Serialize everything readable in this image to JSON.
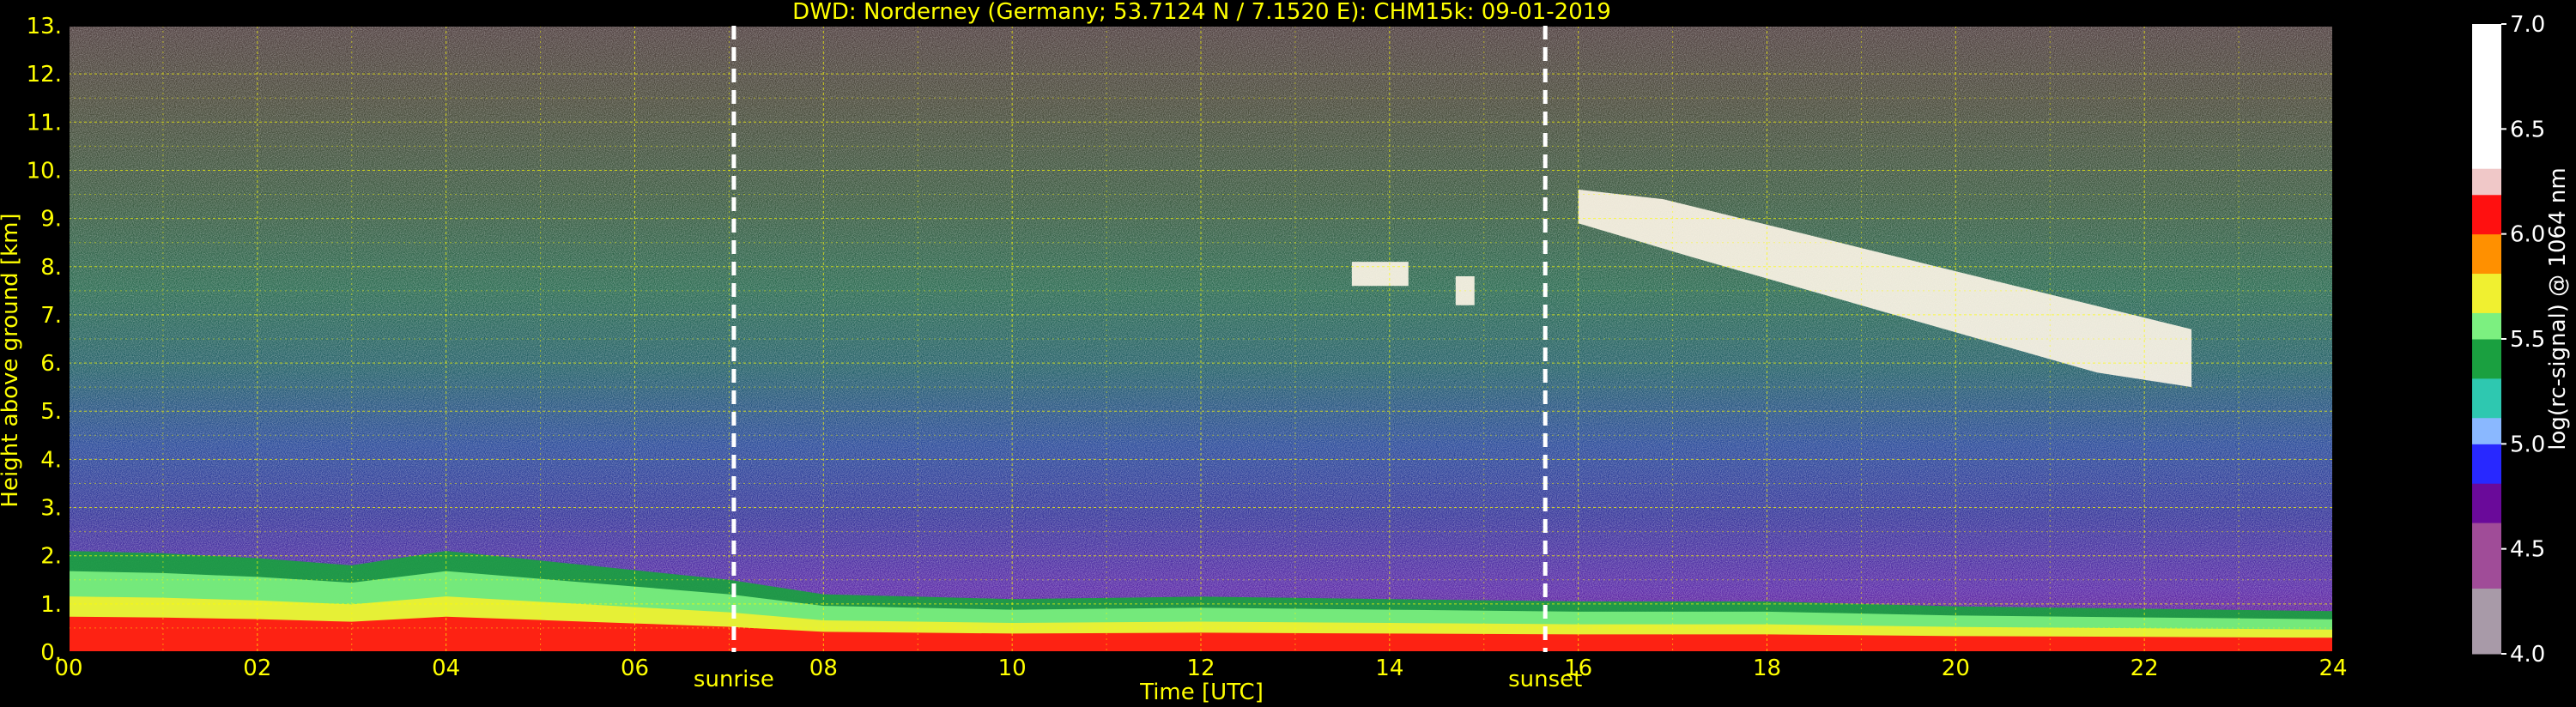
{
  "chart_data": {
    "type": "heatmap",
    "title": "DWD: Norderney (Germany; 53.7124 N / 7.1520 E):    CHM15k: 09-01-2019",
    "xlabel": "Time [UTC]",
    "ylabel": "Height above ground [km]",
    "xlim": [
      0,
      24
    ],
    "ylim": [
      0,
      13
    ],
    "x_ticks": [
      "00",
      "02",
      "04",
      "06",
      "08",
      "10",
      "12",
      "14",
      "16",
      "18",
      "20",
      "22",
      "24"
    ],
    "y_ticks": [
      "0.",
      "1.",
      "2.",
      "3.",
      "4.",
      "5.",
      "6.",
      "7.",
      "8.",
      "9.",
      "10.",
      "11.",
      "12.",
      "13."
    ],
    "grid": true,
    "colorbar": {
      "label": "log(rc-signal) @ 1064 nm",
      "range": [
        4.0,
        7.0
      ],
      "ticks": [
        "4.0",
        "4.5",
        "5.0",
        "5.5",
        "6.0",
        "6.5",
        "7.0"
      ]
    },
    "annotations": [
      {
        "label": "sunrise",
        "time": 7.05
      },
      {
        "label": "sunset",
        "time": 15.65
      }
    ],
    "boundary_layer_top_km": [
      [
        0,
        2.1
      ],
      [
        1,
        2.05
      ],
      [
        2,
        1.95
      ],
      [
        3,
        1.8
      ],
      [
        4,
        2.1
      ],
      [
        5,
        1.9
      ],
      [
        6,
        1.7
      ],
      [
        7,
        1.5
      ],
      [
        8,
        1.2
      ],
      [
        9,
        1.15
      ],
      [
        10,
        1.1
      ],
      [
        12,
        1.15
      ],
      [
        14,
        1.1
      ],
      [
        16,
        1.05
      ],
      [
        18,
        1.05
      ],
      [
        20,
        0.95
      ],
      [
        22,
        0.9
      ],
      [
        24,
        0.85
      ]
    ],
    "cloud_layers": [
      {
        "start": 13.6,
        "end": 14.2,
        "base_km": 7.6,
        "top_km": 8.1
      },
      {
        "start": 14.7,
        "end": 14.9,
        "base_km": 7.2,
        "top_km": 7.8
      },
      {
        "start": 16.0,
        "end": 22.5,
        "base_km": 5.5,
        "top_km": 9.6
      }
    ]
  },
  "colors": {
    "background": "#000000",
    "text": "#ffff00",
    "grid": "#ffff00",
    "colorbar_text": "#ffffff",
    "colorbar_stops": [
      [
        4.0,
        "#a89aa8"
      ],
      [
        4.3,
        "#a04c98"
      ],
      [
        4.6,
        "#6a0a9a"
      ],
      [
        4.8,
        "#2828ff"
      ],
      [
        5.0,
        "#8ab8ff"
      ],
      [
        5.15,
        "#2ec8b0"
      ],
      [
        5.3,
        "#1aa040"
      ],
      [
        5.5,
        "#7cf080"
      ],
      [
        5.65,
        "#f0f030"
      ],
      [
        5.8,
        "#ff9000"
      ],
      [
        6.0,
        "#ff1010"
      ],
      [
        6.2,
        "#f0c8c8"
      ],
      [
        6.3,
        "#ffffff"
      ],
      [
        7.0,
        "#ffffff"
      ]
    ]
  }
}
